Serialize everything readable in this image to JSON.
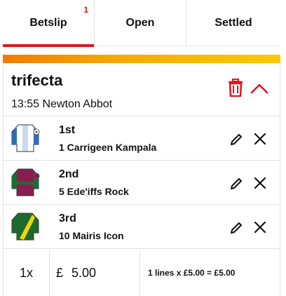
{
  "tabs": [
    {
      "label": "Betslip",
      "badge": "1",
      "active": true
    },
    {
      "label": "Open",
      "active": false
    },
    {
      "label": "Settled",
      "active": false
    }
  ],
  "bet": {
    "type": "trifecta",
    "race": "13:55 Newton Abbot",
    "icons": {
      "delete": "trash-icon",
      "collapse": "chevron-up-icon"
    },
    "selections": [
      {
        "position": "1st",
        "runner": "1 Carrigeen Kampala",
        "silks": {
          "body": "#ffffff",
          "accent": "#2f6db5"
        }
      },
      {
        "position": "2nd",
        "runner": "5 Ede'iffs Rock",
        "silks": {
          "body": "#8a1d4f",
          "accent": "#1f6b35"
        }
      },
      {
        "position": "3rd",
        "runner": "10 Mairis Icon",
        "silks": {
          "body": "#1d6b2c",
          "accent": "#f2d500"
        }
      }
    ]
  },
  "stake": {
    "multiplier": "1x",
    "currency": "£",
    "amount": "5.00",
    "summary": "1 lines x £5.00 = £5.00"
  },
  "colors": {
    "accent": "#e0141e",
    "gradient_start": "#ef7c00",
    "gradient_end": "#ffc800"
  }
}
